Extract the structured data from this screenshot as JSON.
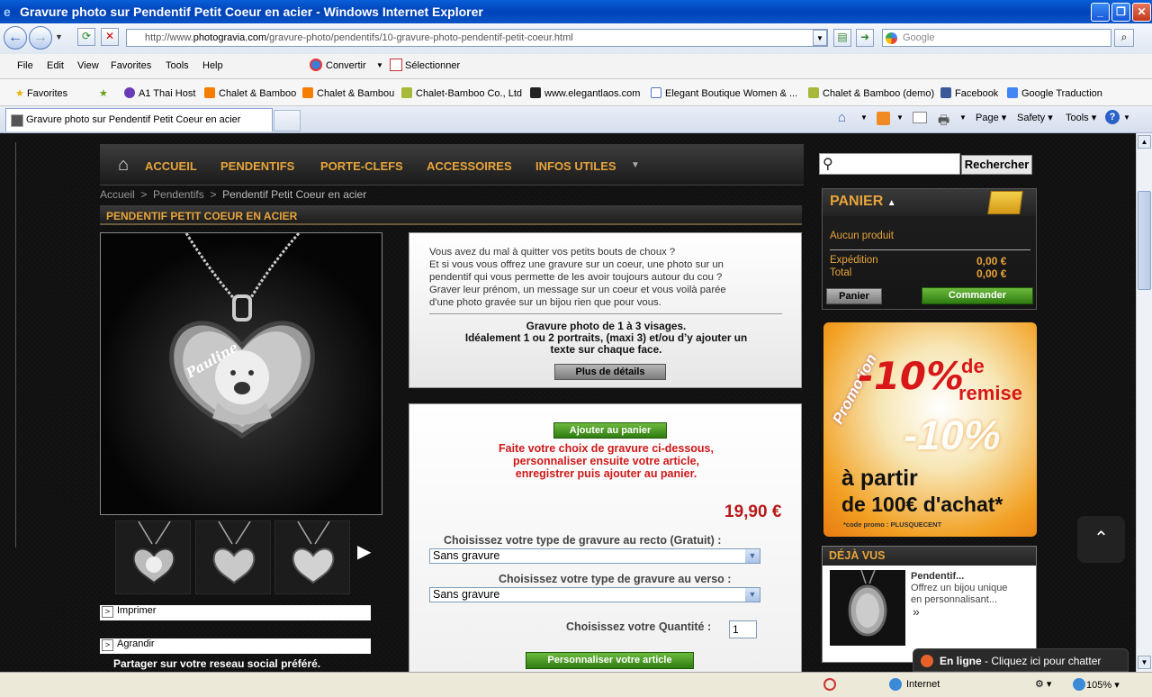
{
  "window": {
    "title": "Gravure photo sur Pendentif Petit Coeur en acier - Windows Internet Explorer"
  },
  "address": {
    "url_prefix": "http://www.",
    "url_domain": "photogravia.com",
    "url_path": "/gravure-photo/pendentifs/10-gravure-photo-pendentif-petit-coeur.html",
    "search_placeholder": "Google"
  },
  "menu": {
    "items": [
      "File",
      "Edit",
      "View",
      "Favorites",
      "Tools",
      "Help"
    ],
    "convertir": "Convertir",
    "selectionner": "Sélectionner"
  },
  "favorites": {
    "label": "Favorites",
    "items": [
      "A1 Thai Host",
      "Chalet & Bamboo",
      "Chalet & Bambou",
      "Chalet-Bamboo Co., Ltd",
      "www.elegantlaos.com",
      "Elegant Boutique Women & ...",
      "Chalet & Bamboo (demo)",
      "Facebook",
      "Google Traduction"
    ]
  },
  "tabs": {
    "active": "Gravure photo sur Pendentif Petit Coeur en acier"
  },
  "commandbar": {
    "page": "Page",
    "safety": "Safety",
    "tools": "Tools"
  },
  "site": {
    "nav": [
      "ACCUEIL",
      "PENDENTIFS",
      "PORTE-CLEFS",
      "ACCESSOIRES",
      "INFOS UTILES"
    ],
    "search_button": "Rechercher",
    "breadcrumb": {
      "home": "Accueil",
      "sep": ">",
      "cat": "Pendentifs",
      "current": "Pendentif Petit Coeur en acier"
    },
    "product_title": "PENDENTIF PETIT COEUR EN ACIER",
    "engraved_name": "Pauline",
    "description": [
      "Vous avez du mal à quitter vos petits bouts de choux ?",
      "Et si vous vous offrez une gravure sur un coeur, une photo sur un",
      "pendentif qui vous permette de les avoir toujours autour du cou ?",
      "Graver leur prénom, un message sur un coeur et vous voilà parée",
      "d'une photo gravée sur un bijou rien que pour vous."
    ],
    "highlight": [
      "Gravure photo de 1 à 3 visages.",
      "Idéalement 1 ou 2 portraits, (maxi 3) et/ou d’y ajouter un",
      "texte sur chaque face."
    ],
    "details_button": "Plus de détails",
    "add_to_cart": "Ajouter au panier",
    "notice": [
      "Faite votre choix de gravure ci-dessous,",
      "personnaliser ensuite votre article,",
      "enregistrer puis ajouter au panier."
    ],
    "price": "19,90 €",
    "recto_label": "Choisissez votre type de gravure au recto (Gratuit) :",
    "recto_value": "Sans gravure",
    "verso_label": "Choisissez votre type de gravure au verso :",
    "verso_value": "Sans gravure",
    "qty_label": "Choisissez votre Quantité :",
    "qty_value": "1",
    "customize_button": "Personnaliser votre article",
    "print": "Imprimer",
    "enlarge": "Agrandir",
    "share": "Partager sur votre reseau social préféré.",
    "cart": {
      "title": "PANIER",
      "empty": "Aucun produit",
      "shipping_label": "Expédition",
      "shipping_value": "0,00 €",
      "total_label": "Total",
      "total_value": "0,00 €",
      "cart_button": "Panier",
      "order_button": "Commander"
    },
    "promo": {
      "ribbon": "Promotion",
      "big": "-10%",
      "de": "de",
      "remise": "remise",
      "ghost": "-10%",
      "line1": "à partir",
      "line2": "de 100€ d'achat*",
      "code": "*code promo : PLUSQUECENT"
    },
    "seen": {
      "title": "DÉJÀ VUS",
      "item_title": "Pendentif...",
      "item_desc": [
        "Offrez un bijou unique",
        "en personnalisant..."
      ],
      "more": "»"
    },
    "chat": {
      "bold": "En ligne",
      "rest": " - Cliquez ici pour chatter"
    }
  },
  "status": {
    "zone": "Internet",
    "zoom": "105%"
  }
}
